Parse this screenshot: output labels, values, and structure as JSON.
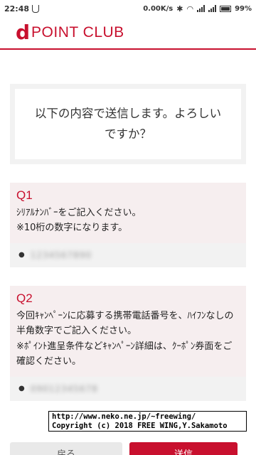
{
  "status_bar": {
    "time": "22:48",
    "speed": "0.00K/s",
    "battery": "99%"
  },
  "header": {
    "logo_mark": "d",
    "logo_text": "POINT CLUB"
  },
  "confirm": {
    "message": "以下の内容で送信します。よろしいですか？"
  },
  "questions": [
    {
      "label": "Q1",
      "text_line1": "ｼﾘｱﾙﾅﾝﾊﾞｰをご記入ください。",
      "text_line2": "※10桁の数字になります。",
      "answer": "1234567890"
    },
    {
      "label": "Q2",
      "text_line1": "今回ｷｬﾝﾍﾟｰﾝに応募する携帯電話番号を、ﾊｲﾌﾝなしの半角数字でご記入ください。",
      "text_line2": "※ﾎﾟｲﾝﾄ進呈条件などｷｬﾝﾍﾟｰﾝ詳細は、ｸｰﾎﾟﾝ券面をご確認ください。",
      "answer": "09012345678"
    }
  ],
  "watermark": {
    "line1": "http://www.neko.ne.jp/~freewing/",
    "line2": "Copyright (c) 2018 FREE WING,Y.Sakamoto"
  },
  "buttons": {
    "back": "戻る",
    "send": "送信"
  }
}
